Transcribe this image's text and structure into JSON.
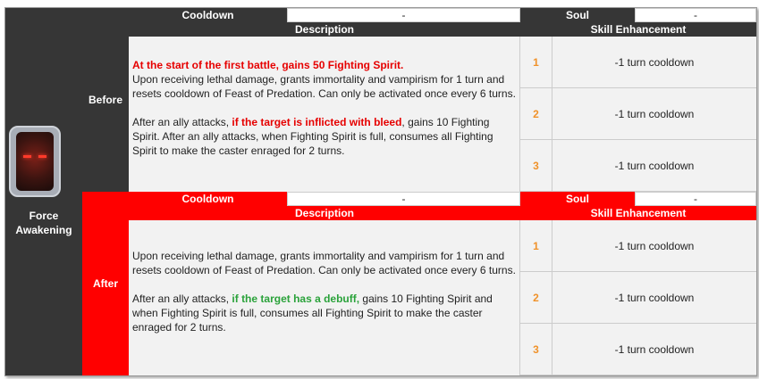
{
  "skill": {
    "name_line1": "Force",
    "name_line2": "Awakening",
    "icon": "character-portrait-icon"
  },
  "colors": {
    "before_accent": "#363636",
    "after_accent": "#ff0000",
    "orange_numbers": "#f0922a",
    "highlight_red": "#e60000",
    "highlight_green": "#2aa23a"
  },
  "before": {
    "phase": "Before",
    "cooldown_label": "Cooldown",
    "cooldown_value": "-",
    "soul_label": "Soul",
    "soul_value": "-",
    "description_label": "Description",
    "enhancement_label": "Skill Enhancement",
    "desc_p1_red": "At the start of the first battle, gains 50 Fighting Spirit.",
    "desc_p1": "Upon receiving lethal damage, grants immortality and vampirism for 1 turn and resets cooldown of Feast of Predation. Can only be activated once every 6 turns.",
    "desc_p2_pre": "After an ally attacks, ",
    "desc_p2_red": "if the target is inflicted with bleed",
    "desc_p2_post": ", gains 10 Fighting Spirit. After an ally attacks, when Fighting Spirit is full, consumes all Fighting Spirit to make the caster enraged for 2 turns.",
    "enhancements": [
      {
        "num": "1",
        "text": "-1 turn cooldown"
      },
      {
        "num": "2",
        "text": "-1 turn cooldown"
      },
      {
        "num": "3",
        "text": "-1 turn cooldown"
      }
    ]
  },
  "after": {
    "phase": "After",
    "cooldown_label": "Cooldown",
    "cooldown_value": "-",
    "soul_label": "Soul",
    "soul_value": "-",
    "description_label": "Description",
    "enhancement_label": "Skill Enhancement",
    "desc_p1": "Upon receiving lethal damage, grants immortality and vampirism for 1 turn and resets cooldown of Feast of Predation. Can only be activated once every 6 turns.",
    "desc_p2_pre": "After an ally attacks, ",
    "desc_p2_green": "the target has a debuff,",
    "desc_p2_post": " gains 10 Fighting Spirit and when Fighting Spirit is full, consumes all Fighting Spirit to make the caster enraged for 2 turns.",
    "desc_p2_green_prefix": "if ",
    "enhancements": [
      {
        "num": "1",
        "text": "-1 turn cooldown"
      },
      {
        "num": "2",
        "text": "-1 turn cooldown"
      },
      {
        "num": "3",
        "text": "-1 turn cooldown"
      }
    ]
  }
}
